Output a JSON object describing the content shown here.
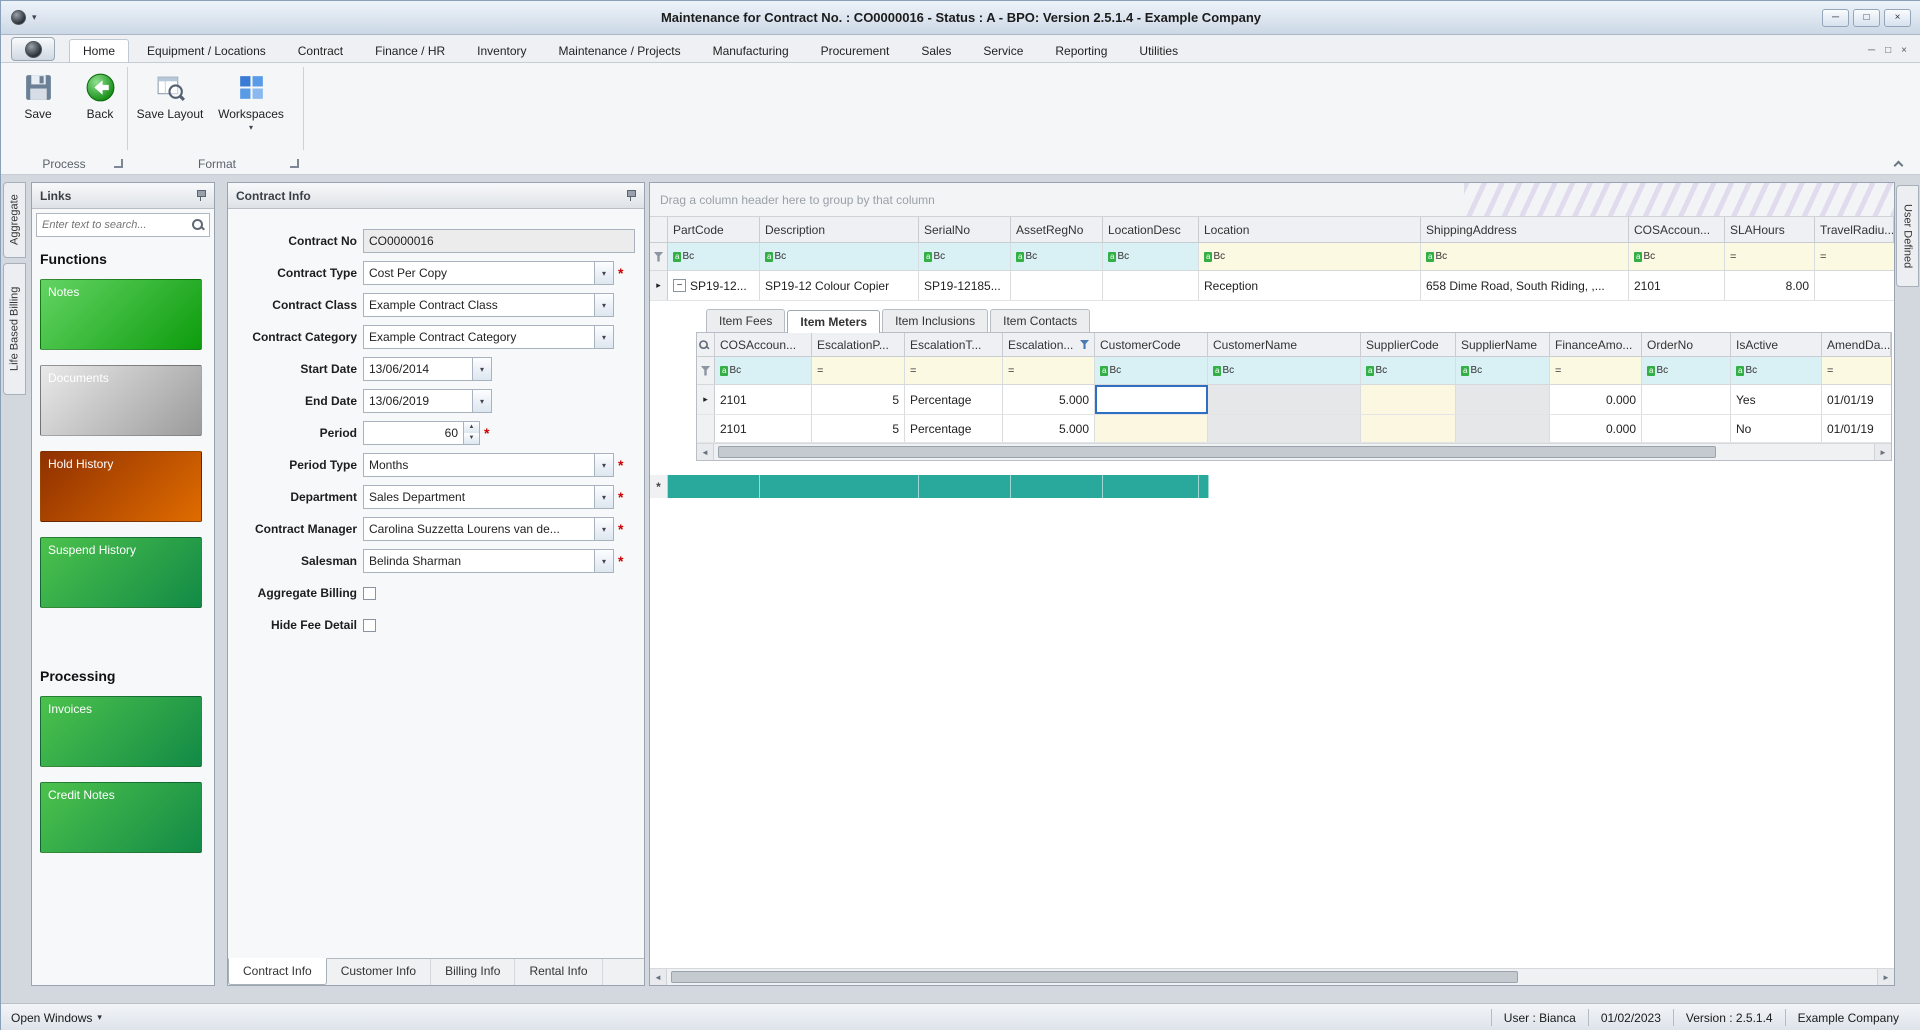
{
  "window": {
    "title": "Maintenance for Contract No. : CO0000016 - Status : A - BPO: Version 2.5.1.4 - Example Company",
    "minimize": "─",
    "maximize": "□",
    "close": "×"
  },
  "menu": {
    "tabs": [
      "Home",
      "Equipment / Locations",
      "Contract",
      "Finance / HR",
      "Inventory",
      "Maintenance / Projects",
      "Manufacturing",
      "Procurement",
      "Sales",
      "Service",
      "Reporting",
      "Utilities"
    ]
  },
  "ribbon": {
    "save_label": "Save",
    "back_label": "Back",
    "save_layout_label": "Save Layout",
    "workspaces_label": "Workspaces",
    "process_group": "Process",
    "format_group": "Format"
  },
  "side_tabs": {
    "aggregate": "Aggregate",
    "life_based_billing": "Life Based Billing",
    "user_defined": "User Defined"
  },
  "links": {
    "title": "Links",
    "search_placeholder": "Enter text to search...",
    "functions_heading": "Functions",
    "processing_heading": "Processing",
    "buttons": {
      "notes": "Notes",
      "documents": "Documents",
      "hold_history": "Hold History",
      "suspend_history": "Suspend History",
      "invoices": "Invoices",
      "credit_notes": "Credit Notes"
    }
  },
  "contract": {
    "panel_title": "Contract Info",
    "required_marker": "*",
    "labels": {
      "contract_no": "Contract No",
      "contract_type": "Contract Type",
      "contract_class": "Contract Class",
      "contract_category": "Contract Category",
      "start_date": "Start Date",
      "end_date": "End Date",
      "period": "Period",
      "period_type": "Period Type",
      "department": "Department",
      "contract_manager": "Contract Manager",
      "salesman": "Salesman",
      "aggregate_billing": "Aggregate Billing",
      "hide_fee_detail": "Hide Fee Detail"
    },
    "values": {
      "contract_no": "CO0000016",
      "contract_type": "Cost Per Copy",
      "contract_class": "Example Contract Class",
      "contract_category": "Example Contract Category",
      "start_date": "13/06/2014",
      "end_date": "13/06/2019",
      "period": "60",
      "period_type": "Months",
      "department": "Sales Department",
      "contract_manager": "Carolina Suzzetta Lourens van de...",
      "salesman": "Belinda Sharman"
    },
    "bottom_tabs": [
      "Contract Info",
      "Customer Info",
      "Billing Info",
      "Rental Info"
    ]
  },
  "grid": {
    "group_hint": "Drag a column header here to group by that column",
    "columns": [
      "PartCode",
      "Description",
      "SerialNo",
      "AssetRegNo",
      "LocationDesc",
      "Location",
      "ShippingAddress",
      "COSAccoun...",
      "SLAHours",
      "TravelRadiu..."
    ],
    "row": [
      "SP19-12...",
      "SP19-12 Colour Copier",
      "SP19-12185...",
      "",
      "",
      "Reception",
      "658 Dime Road, South Riding, ,...",
      "2101",
      "8.00",
      ""
    ],
    "detail": {
      "tabs": [
        "Item Fees",
        "Item Meters",
        "Item Inclusions",
        "Item Contacts"
      ],
      "columns": [
        "COSAccoun...",
        "EscalationP...",
        "EscalationT...",
        "Escalation...",
        "CustomerCode",
        "CustomerName",
        "SupplierCode",
        "SupplierName",
        "FinanceAmo...",
        "OrderNo",
        "IsActive",
        "AmendDa..."
      ],
      "rows": [
        [
          "2101",
          "5",
          "Percentage",
          "5.000",
          "",
          "",
          "",
          "",
          "0.000",
          "",
          "Yes",
          "01/01/19"
        ],
        [
          "2101",
          "5",
          "Percentage",
          "5.000",
          "",
          "",
          "",
          "",
          "0.000",
          "",
          "No",
          "01/01/19"
        ]
      ]
    }
  },
  "status_bar": {
    "open_windows": "Open Windows",
    "user": "User : Bianca",
    "date": "01/02/2023",
    "version": "Version : 2.5.1.4",
    "company": "Example Company"
  },
  "icons": {
    "dropdown": "▾",
    "minus": "−",
    "row_arrow": "▸",
    "filter_a": "a",
    "filter_bc": "Bc",
    "equals": "=",
    "asterisk": "*",
    "scroll_left": "◄",
    "scroll_right": "►",
    "spin_up": "▲",
    "spin_down": "▼"
  }
}
